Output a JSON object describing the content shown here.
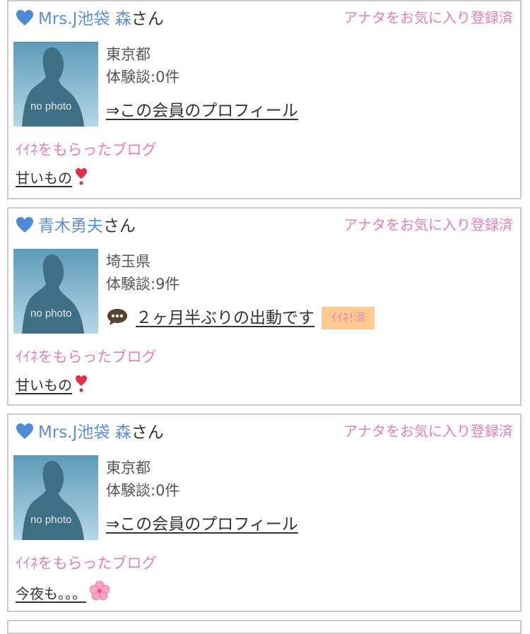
{
  "cards": [
    {
      "member_name": "Mrs.J池袋 森",
      "honorific": "さん",
      "favorite_status": "アナタをお気に入り登録済",
      "prefecture": "東京都",
      "experience_count": "体験談:0件",
      "link_text": "⇒この会員のプロフィール",
      "liked_blog_heading": "ｲｲﾈをもらったブログ",
      "blog_title": "甘いもの",
      "blog_emoji": "heart-exclamation-icon",
      "photo_placeholder": "no photo"
    },
    {
      "member_name": "青木勇夫",
      "honorific": "さん",
      "favorite_status": "アナタをお気に入り登録済",
      "prefecture": "埼玉県",
      "experience_count": "体験談:9件",
      "link_text": "２ヶ月半ぶりの出動です",
      "link_icon": "speech-bubble-icon",
      "iine_badge": "ｲｲﾈ!済",
      "liked_blog_heading": "ｲｲﾈをもらったブログ",
      "blog_title": "甘いもの",
      "blog_emoji": "heart-exclamation-icon",
      "photo_placeholder": "no photo"
    },
    {
      "member_name": "Mrs.J池袋 森",
      "honorific": "さん",
      "favorite_status": "アナタをお気に入り登録済",
      "prefecture": "東京都",
      "experience_count": "体験談:0件",
      "link_text": "⇒この会員のプロフィール",
      "liked_blog_heading": "ｲｲﾈをもらったブログ",
      "blog_title": "今夜も。。。",
      "blog_emoji": "cherry-blossom-icon",
      "photo_placeholder": "no photo"
    }
  ],
  "colors": {
    "name_blue": "#5b8fd6",
    "accent_pink": "#e57fb7",
    "badge_orange": "#ffc98f",
    "border_gray": "#cccccc"
  }
}
